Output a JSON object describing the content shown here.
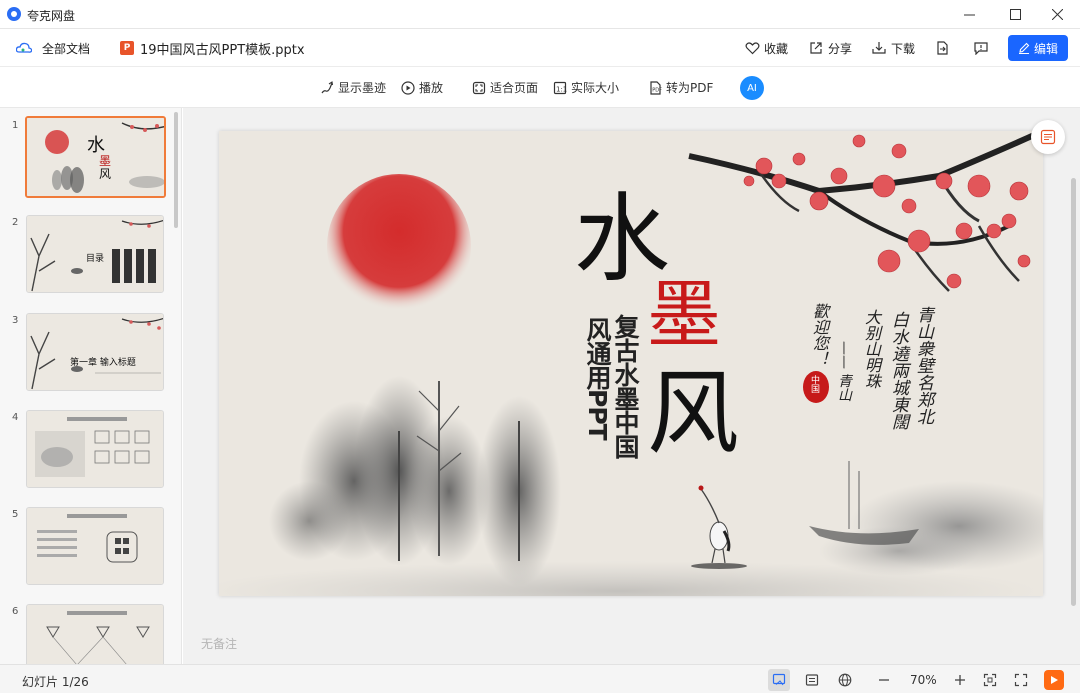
{
  "window": {
    "app_title": "夸克网盘",
    "minimize_icon": "minimize-icon",
    "maximize_icon": "maximize-icon",
    "close_icon": "close-icon"
  },
  "toolbar": {
    "all_docs": "全部文档",
    "file_name": "19中国风古风PPT模板.pptx",
    "favorite": "收藏",
    "share": "分享",
    "download": "下载",
    "edit": "编辑"
  },
  "viewer_toolbar": {
    "show_ink": "显示墨迹",
    "play": "播放",
    "fit_page": "适合页面",
    "actual_size": "实际大小",
    "to_pdf": "转为PDF",
    "ai_label": "AI"
  },
  "thumbnails": [
    {
      "num": "1",
      "label": ""
    },
    {
      "num": "2",
      "label": "目录"
    },
    {
      "num": "3",
      "label": "第一章 输入标题"
    },
    {
      "num": "4",
      "label": ""
    },
    {
      "num": "5",
      "label": ""
    },
    {
      "num": "6",
      "label": ""
    }
  ],
  "slide": {
    "title_1": "水",
    "title_2": "墨",
    "title_3": "风",
    "subtitle_1": "复古水墨中国",
    "subtitle_2": "风通用PPT",
    "calligraphy_1": "青山衆壁名郑北",
    "calligraphy_2": "白水遶兩城東闊",
    "calligraphy_3": "大别山明珠",
    "calligraphy_4": "歡迎您！",
    "calligraphy_5": "—— 青山",
    "seal": "中国"
  },
  "notes": {
    "placeholder": "无备注"
  },
  "status": {
    "slide_counter": "幻灯片 1/26",
    "zoom": "70%"
  },
  "colors": {
    "accent": "#1a66ff",
    "thumb_active": "#f07b3a",
    "seal_red": "#c61a1a",
    "play_orange": "#ff6a13"
  }
}
